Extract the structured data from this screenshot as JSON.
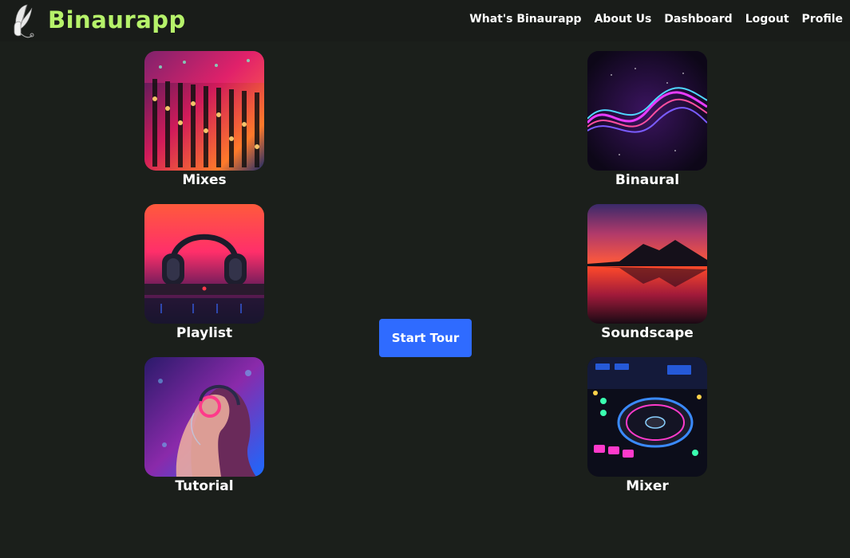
{
  "brand": {
    "name": "Binaurapp",
    "logo_icon": "headphones-feather-icon"
  },
  "nav": {
    "items": [
      "What's Binaurapp",
      "About Us",
      "Dashboard",
      "Logout",
      "Profile"
    ]
  },
  "tiles": [
    {
      "label": "Mixes",
      "image": "mixing-console-image"
    },
    {
      "label": "Binaural",
      "image": "neon-soundwave-image"
    },
    {
      "label": "Playlist",
      "image": "headphones-sunset-image"
    },
    {
      "label": "Soundscape",
      "image": "mountain-lake-sunset-image"
    },
    {
      "label": "Tutorial",
      "image": "woman-headphones-neon-image"
    },
    {
      "label": "Mixer",
      "image": "dj-controller-image"
    }
  ],
  "start_tour": {
    "label": "Start Tour"
  },
  "colors": {
    "background": "#1b1f1b",
    "brand": "#b6f26a",
    "button": "#2f6bff"
  }
}
